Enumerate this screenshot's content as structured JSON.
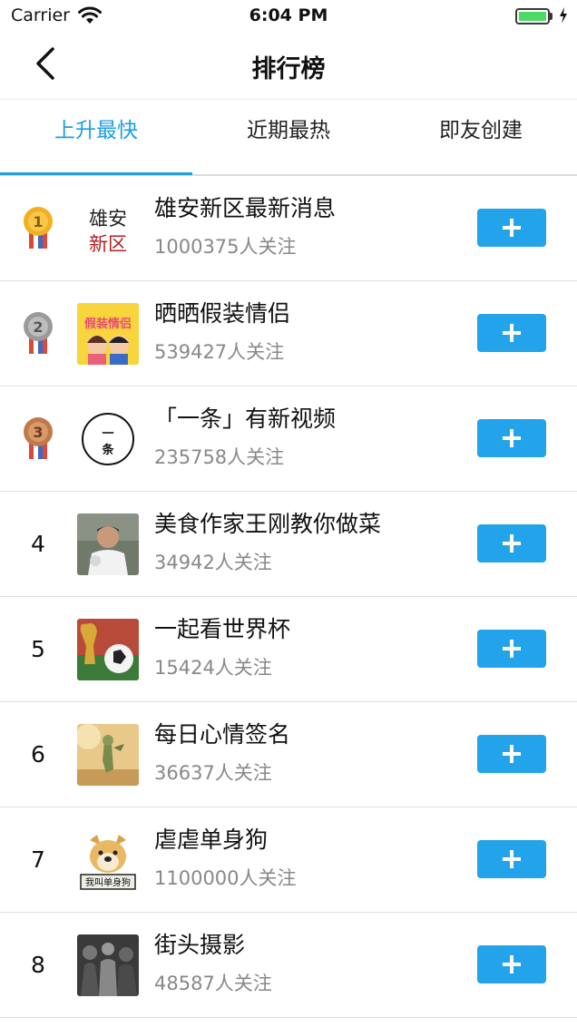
{
  "status_bar": {
    "carrier": "Carrier",
    "time": "6:04 PM",
    "battery_color": "#4cd964"
  },
  "nav": {
    "title": "排行榜",
    "back_icon": "chevron-left-icon"
  },
  "tabs": [
    {
      "label": "上升最快",
      "active": true
    },
    {
      "label": "近期最热",
      "active": false
    },
    {
      "label": "即友创建",
      "active": false
    }
  ],
  "accent_color": "#1e9ee6",
  "button_color": "#22a3ea",
  "list": [
    {
      "rank": "1",
      "medal": "gold-medal-icon",
      "name": "雄安新区最新消息",
      "followers": "1000375人关注",
      "thumb": "xiongan-logo",
      "thumb_text": [
        "雄安",
        "新区"
      ]
    },
    {
      "rank": "2",
      "medal": "silver-medal-icon",
      "name": "晒晒假装情侣",
      "followers": "539427人关注",
      "thumb": "couple-cartoon",
      "thumb_text": [
        "假装情侣"
      ]
    },
    {
      "rank": "3",
      "medal": "bronze-medal-icon",
      "name": "「一条」有新视频",
      "followers": "235758人关注",
      "thumb": "yitiao-logo",
      "thumb_text": [
        "一",
        "条"
      ]
    },
    {
      "rank": "4",
      "medal": "",
      "name": "美食作家王刚教你做菜",
      "followers": "34942人关注",
      "thumb": "chef-photo",
      "thumb_text": []
    },
    {
      "rank": "5",
      "medal": "",
      "name": "一起看世界杯",
      "followers": "15424人关注",
      "thumb": "world-cup-photo",
      "thumb_text": []
    },
    {
      "rank": "6",
      "medal": "",
      "name": "每日心情签名",
      "followers": "36637人关注",
      "thumb": "toy-figure-photo",
      "thumb_text": []
    },
    {
      "rank": "7",
      "medal": "",
      "name": "虐虐单身狗",
      "followers": "1100000人关注",
      "thumb": "doge-meme",
      "thumb_text": [
        "我叫单身狗"
      ]
    },
    {
      "rank": "8",
      "medal": "",
      "name": "街头摄影",
      "followers": "48587人关注",
      "thumb": "street-photo",
      "thumb_text": []
    }
  ]
}
